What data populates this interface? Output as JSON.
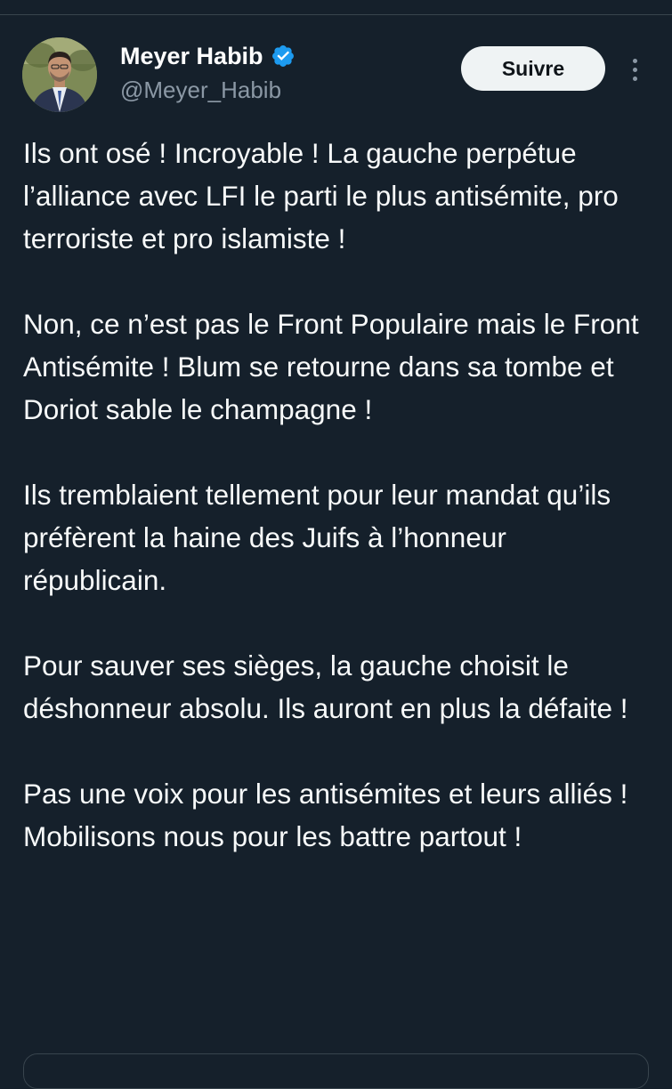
{
  "tweet": {
    "author": {
      "display_name": "Meyer Habib",
      "handle": "@Meyer_Habib",
      "verified": true,
      "avatar_icon": "profile-photo"
    },
    "follow_label": "Suivre",
    "more_icon": "more-options-icon",
    "paragraphs": [
      "Ils ont osé ! Incroyable ! La gauche perpétue l’alliance avec LFI le parti le plus antisémite, pro terroriste et pro islamiste !",
      "Non, ce n’est pas le Front Populaire mais le Front Antisémite ! Blum se retourne dans sa tombe et Doriot sable le champagne !",
      "Ils tremblaient tellement pour leur mandat qu’ils préfèrent la haine des Juifs à l’honneur républicain.",
      "Pour sauver ses sièges, la gauche choisit le déshonneur absolu. Ils auront en plus la défaite !",
      "Pas une voix pour les antisémites et leurs alliés ! Mobilisons nous pour les battre partout !"
    ]
  },
  "colors": {
    "background": "#15202b",
    "text": "#f7f9f9",
    "secondary_text": "#8b98a5",
    "verified_blue": "#1d9bf0",
    "button_bg": "#eff3f4",
    "border": "#38444d"
  }
}
